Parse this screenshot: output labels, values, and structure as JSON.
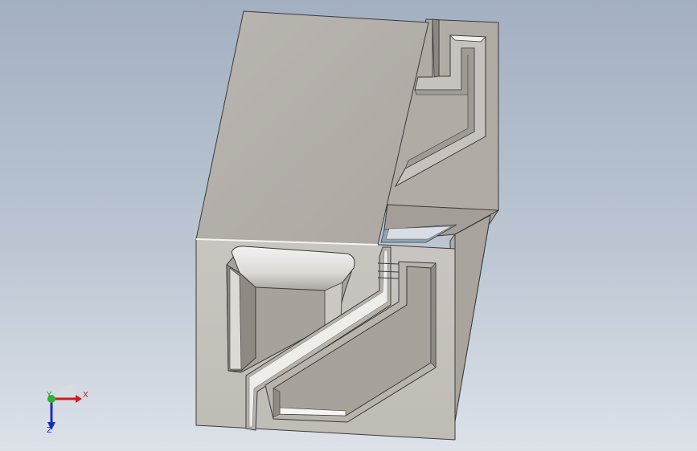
{
  "view": {
    "background_top": "#a3b0c2",
    "background_bottom": "#dde2e9",
    "part_color": "#b5b0aa"
  },
  "triad": {
    "x_label": "X",
    "y_label": "Y",
    "z_label": "Z",
    "x_color": "#d11a1a",
    "y_color": "#1f9c2a",
    "z_color": "#1b2bbd"
  }
}
